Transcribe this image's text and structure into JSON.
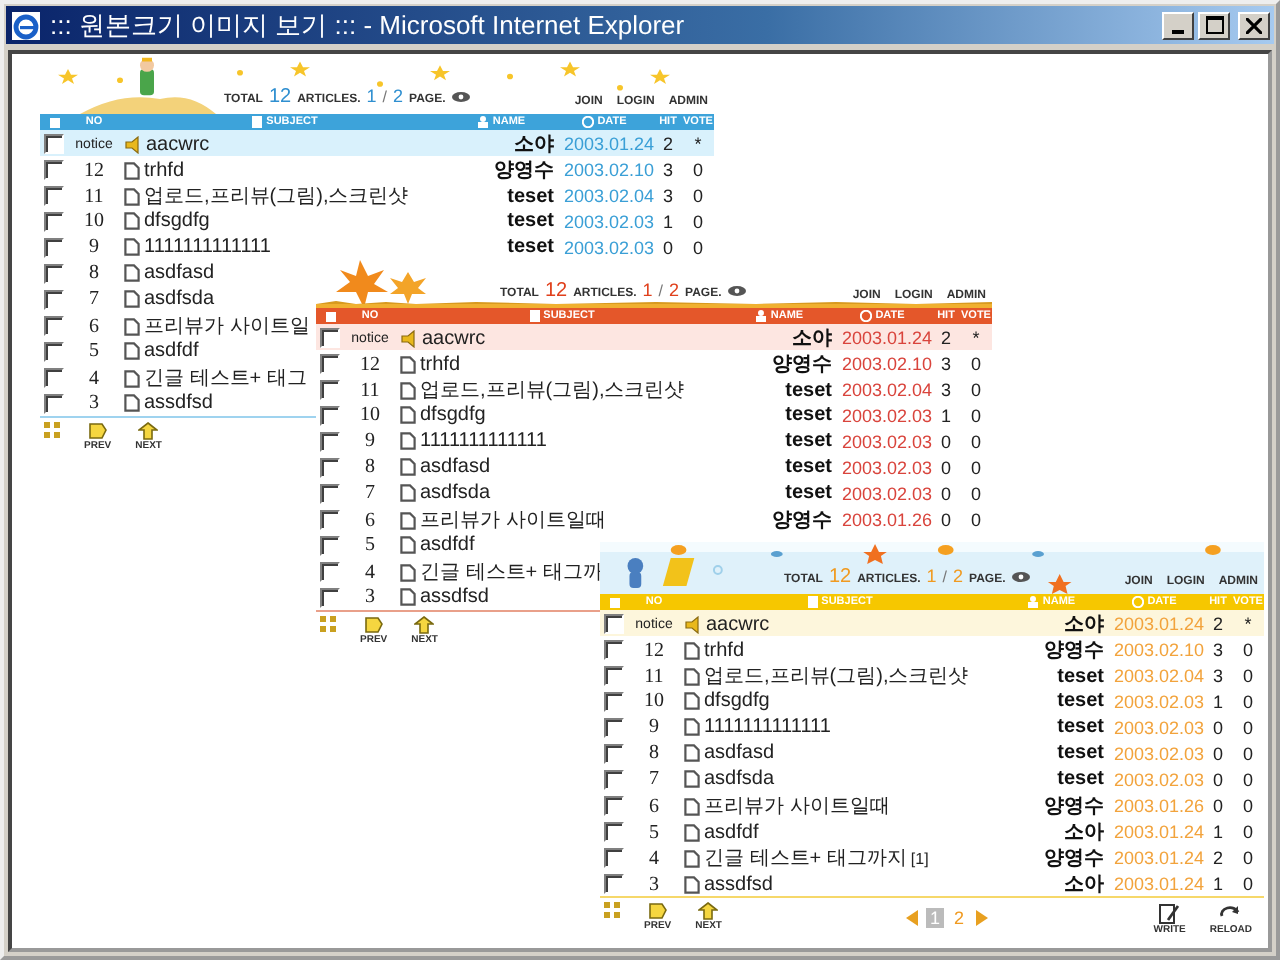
{
  "window": {
    "title": "::: 원본크기 이미지 보기 ::: - Microsoft Internet Explorer"
  },
  "boards": [
    {
      "kind": "stars",
      "stats": {
        "total_label": "TOTAL",
        "total": "12",
        "articles_label": "ARTICLES.",
        "page": "1",
        "sep": "/",
        "pages": "2",
        "page_label": "PAGE."
      },
      "links": [
        "JOIN",
        "LOGIN",
        "ADMIN"
      ],
      "columns": [
        "NO",
        "SUBJECT",
        "NAME",
        "DATE",
        "HIT",
        "VOTE"
      ],
      "rows": [
        {
          "kind": "notice",
          "checked": false,
          "no": "notice",
          "subject": "aacwrc",
          "name": "소야",
          "date": "2003.01.24",
          "hit": "2",
          "vote": "*"
        },
        {
          "kind": "post",
          "checked": false,
          "no": "12",
          "subject": "trhfd",
          "name": "양영수",
          "date": "2003.02.10",
          "hit": "3",
          "vote": "0"
        },
        {
          "kind": "post",
          "checked": false,
          "no": "11",
          "subject": "업로드,프리뷰(그림),스크린샷",
          "name": "teset",
          "date": "2003.02.04",
          "hit": "3",
          "vote": "0"
        },
        {
          "kind": "post",
          "checked": false,
          "no": "10",
          "subject": "dfsgdfg",
          "name": "teset",
          "date": "2003.02.03",
          "hit": "1",
          "vote": "0"
        },
        {
          "kind": "post",
          "checked": false,
          "no": "9",
          "subject": "1111111111111",
          "name": "teset",
          "date": "2003.02.03",
          "hit": "0",
          "vote": "0"
        },
        {
          "kind": "post",
          "checked": false,
          "no": "8",
          "subject": "asdfasd"
        },
        {
          "kind": "post",
          "checked": false,
          "no": "7",
          "subject": "asdfsda"
        },
        {
          "kind": "post",
          "checked": false,
          "no": "6",
          "subject": "프리뷰가 사이트일"
        },
        {
          "kind": "post",
          "checked": false,
          "no": "5",
          "subject": "asdfdf"
        },
        {
          "kind": "post",
          "checked": false,
          "no": "4",
          "subject": "긴글 테스트+ 태그"
        },
        {
          "kind": "post",
          "checked": false,
          "no": "3",
          "subject": "assdfsd"
        }
      ],
      "footer": {
        "prev": "PREV",
        "next": "NEXT"
      }
    },
    {
      "kind": "autumn",
      "stats": {
        "total_label": "TOTAL",
        "total": "12",
        "articles_label": "ARTICLES.",
        "page": "1",
        "sep": "/",
        "pages": "2",
        "page_label": "PAGE."
      },
      "links": [
        "JOIN",
        "LOGIN",
        "ADMIN"
      ],
      "columns": [
        "NO",
        "SUBJECT",
        "NAME",
        "DATE",
        "HIT",
        "VOTE"
      ],
      "rows": [
        {
          "kind": "notice",
          "checked": false,
          "no": "notice",
          "subject": "aacwrc",
          "name": "소야",
          "date": "2003.01.24",
          "hit": "2",
          "vote": "*"
        },
        {
          "kind": "post",
          "checked": false,
          "no": "12",
          "subject": "trhfd",
          "name": "양영수",
          "date": "2003.02.10",
          "hit": "3",
          "vote": "0"
        },
        {
          "kind": "post",
          "checked": false,
          "no": "11",
          "subject": "업로드,프리뷰(그림),스크린샷",
          "name": "teset",
          "date": "2003.02.04",
          "hit": "3",
          "vote": "0"
        },
        {
          "kind": "post",
          "checked": false,
          "no": "10",
          "subject": "dfsgdfg",
          "name": "teset",
          "date": "2003.02.03",
          "hit": "1",
          "vote": "0"
        },
        {
          "kind": "post",
          "checked": false,
          "no": "9",
          "subject": "1111111111111",
          "name": "teset",
          "date": "2003.02.03",
          "hit": "0",
          "vote": "0"
        },
        {
          "kind": "post",
          "checked": false,
          "no": "8",
          "subject": "asdfasd",
          "name": "teset",
          "date": "2003.02.03",
          "hit": "0",
          "vote": "0"
        },
        {
          "kind": "post",
          "checked": false,
          "no": "7",
          "subject": "asdfsda",
          "name": "teset",
          "date": "2003.02.03",
          "hit": "0",
          "vote": "0"
        },
        {
          "kind": "post",
          "checked": false,
          "no": "6",
          "subject": "프리뷰가 사이트일때",
          "name": "양영수",
          "date": "2003.01.26",
          "hit": "0",
          "vote": "0"
        },
        {
          "kind": "post",
          "checked": false,
          "no": "5",
          "subject": "asdfdf"
        },
        {
          "kind": "post",
          "checked": false,
          "no": "4",
          "subject": "긴글 테스트+ 태그까"
        },
        {
          "kind": "post",
          "checked": false,
          "no": "3",
          "subject": "assdfsd"
        }
      ],
      "footer": {
        "prev": "PREV",
        "next": "NEXT"
      }
    },
    {
      "kind": "sea",
      "stats": {
        "total_label": "TOTAL",
        "total": "12",
        "articles_label": "ARTICLES.",
        "page": "1",
        "sep": "/",
        "pages": "2",
        "page_label": "PAGE."
      },
      "links": [
        "JOIN",
        "LOGIN",
        "ADMIN"
      ],
      "columns": [
        "NO",
        "SUBJECT",
        "NAME",
        "DATE",
        "HIT",
        "VOTE"
      ],
      "rows": [
        {
          "kind": "notice",
          "checked": false,
          "no": "notice",
          "subject": "aacwrc",
          "name": "소야",
          "date": "2003.01.24",
          "hit": "2",
          "vote": "*"
        },
        {
          "kind": "post",
          "checked": false,
          "no": "12",
          "subject": "trhfd",
          "name": "양영수",
          "date": "2003.02.10",
          "hit": "3",
          "vote": "0"
        },
        {
          "kind": "post",
          "checked": false,
          "no": "11",
          "subject": "업로드,프리뷰(그림),스크린샷",
          "name": "teset",
          "date": "2003.02.04",
          "hit": "3",
          "vote": "0"
        },
        {
          "kind": "post",
          "checked": false,
          "no": "10",
          "subject": "dfsgdfg",
          "name": "teset",
          "date": "2003.02.03",
          "hit": "1",
          "vote": "0"
        },
        {
          "kind": "post",
          "checked": false,
          "no": "9",
          "subject": "1111111111111",
          "name": "teset",
          "date": "2003.02.03",
          "hit": "0",
          "vote": "0"
        },
        {
          "kind": "post",
          "checked": false,
          "no": "8",
          "subject": "asdfasd",
          "name": "teset",
          "date": "2003.02.03",
          "hit": "0",
          "vote": "0"
        },
        {
          "kind": "post",
          "checked": false,
          "no": "7",
          "subject": "asdfsda",
          "name": "teset",
          "date": "2003.02.03",
          "hit": "0",
          "vote": "0"
        },
        {
          "kind": "post",
          "checked": false,
          "no": "6",
          "subject": "프리뷰가 사이트일때",
          "name": "양영수",
          "date": "2003.01.26",
          "hit": "0",
          "vote": "0"
        },
        {
          "kind": "post",
          "checked": false,
          "no": "5",
          "subject": "asdfdf",
          "name": "소아",
          "date": "2003.01.24",
          "hit": "1",
          "vote": "0"
        },
        {
          "kind": "post",
          "checked": false,
          "no": "4",
          "subject": "긴글 테스트+ 태그까지",
          "comments": "[1]",
          "name": "양영수",
          "date": "2003.01.24",
          "hit": "2",
          "vote": "0"
        },
        {
          "kind": "post",
          "checked": false,
          "no": "3",
          "subject": "assdfsd",
          "name": "소아",
          "date": "2003.01.24",
          "hit": "1",
          "vote": "0"
        }
      ],
      "footer": {
        "prev": "PREV",
        "next": "NEXT",
        "pages": [
          {
            "label": "1",
            "selected": true
          },
          {
            "label": "2",
            "selected": false
          }
        ],
        "tools": [
          {
            "kind": "write",
            "label": "WRITE"
          },
          {
            "kind": "reload",
            "label": "RELOAD"
          }
        ]
      }
    }
  ]
}
